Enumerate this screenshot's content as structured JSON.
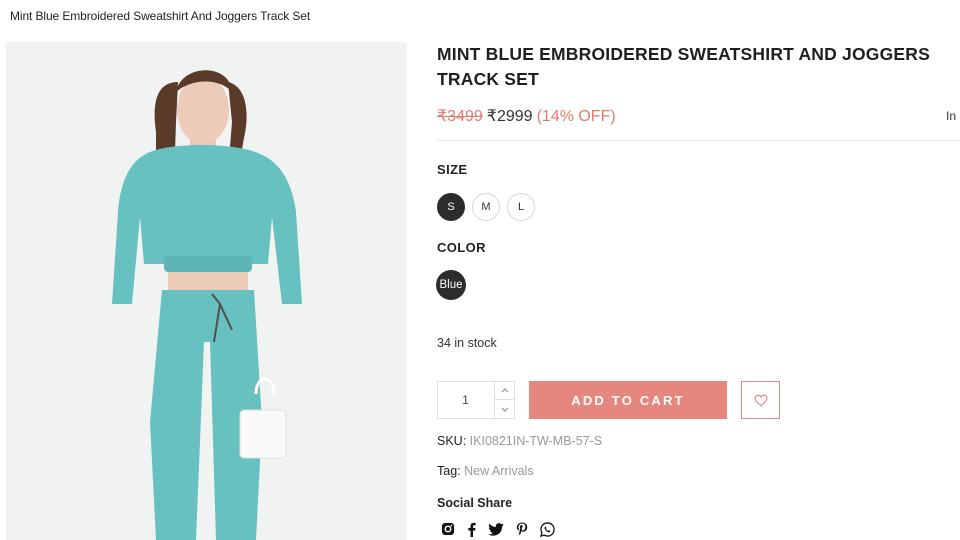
{
  "breadcrumb": "Mint Blue Embroidered Sweatshirt And Joggers Track Set",
  "product": {
    "title": "MINT BLUE EMBROIDERED SWEATSHIRT AND JOGGERS TRACK SET",
    "price_old": "₹3499",
    "price_new": "₹2999",
    "discount": "(14% OFF)",
    "price_aside": "In",
    "size_label": "SIZE",
    "sizes": [
      "S",
      "M",
      "L"
    ],
    "selected_size": "S",
    "color_label": "COLOR",
    "colors": [
      "Blue"
    ],
    "stock": "34 in stock",
    "quantity": "1",
    "add_to_cart": "ADD TO CART",
    "sku_label": "SKU:",
    "sku": "IKI0821IN-TW-MB-57-S",
    "tag_label": "Tag:",
    "tag": "New Arrivals",
    "social_title": "Social Share",
    "social_icons": [
      "instagram-icon",
      "facebook-icon",
      "twitter-icon",
      "pinterest-icon",
      "whatsapp-icon"
    ]
  },
  "colors": {
    "accent": "#e6877f",
    "price_accent": "#e27a6f",
    "swatch_selected": "#2c2c2c",
    "garment": "#66c1c0"
  }
}
